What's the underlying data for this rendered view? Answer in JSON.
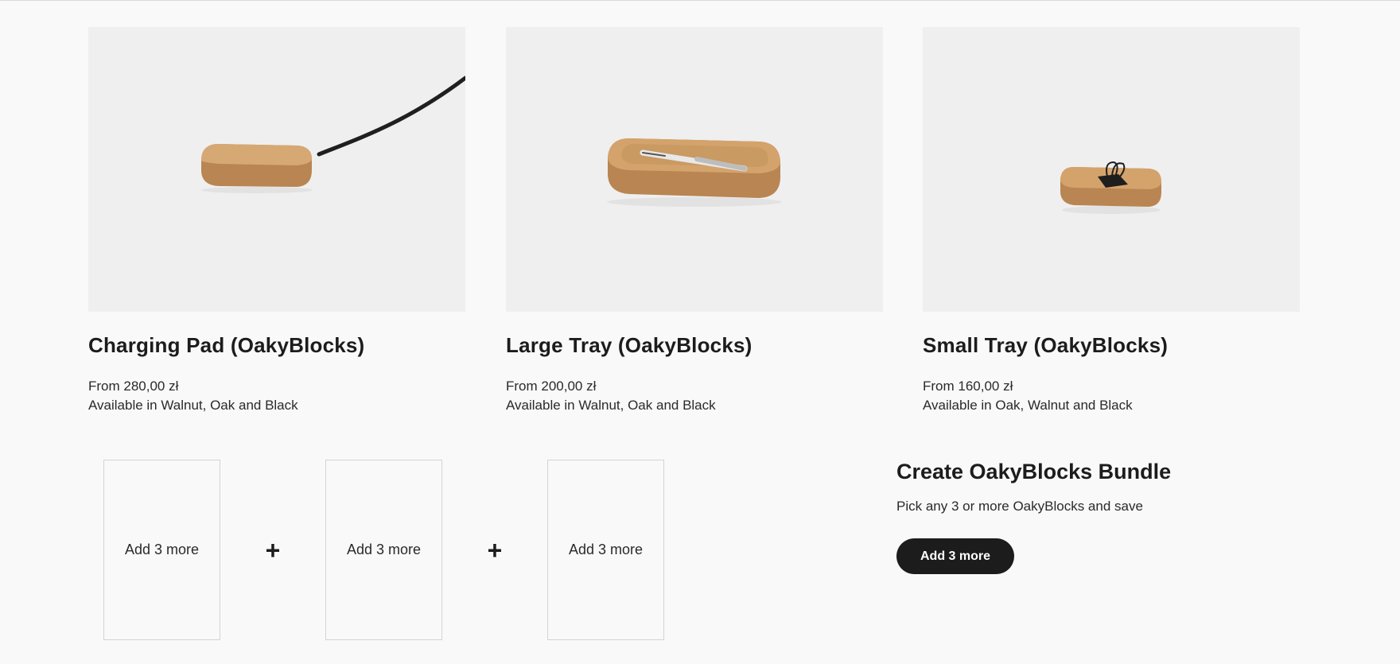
{
  "products": [
    {
      "name": "Charging Pad (OakyBlocks)",
      "price": "From 280,00 zł",
      "availability": "Available in Walnut, Oak and Black",
      "image_icon": "charging-pad-image"
    },
    {
      "name": "Large Tray (OakyBlocks)",
      "price": "From 200,00 zł",
      "availability": "Available in Walnut, Oak and Black",
      "image_icon": "large-tray-image"
    },
    {
      "name": "Small Tray (OakyBlocks)",
      "price": "From 160,00 zł",
      "availability": "Available in Oak, Walnut and Black",
      "image_icon": "small-tray-image"
    }
  ],
  "bundle": {
    "slots": [
      "Add 3 more",
      "Add 3 more",
      "Add 3 more"
    ],
    "plus": "+",
    "title": "Create OakyBlocks Bundle",
    "subtitle": "Pick any 3 or more OakyBlocks and save",
    "button_label": "Add 3 more"
  },
  "colors": {
    "background": "#f9f9f9",
    "image_bg": "#efefef",
    "wood": "#c8955c",
    "text": "#1c1c1c",
    "button_bg": "#1c1c1c",
    "button_text": "#ffffff"
  }
}
